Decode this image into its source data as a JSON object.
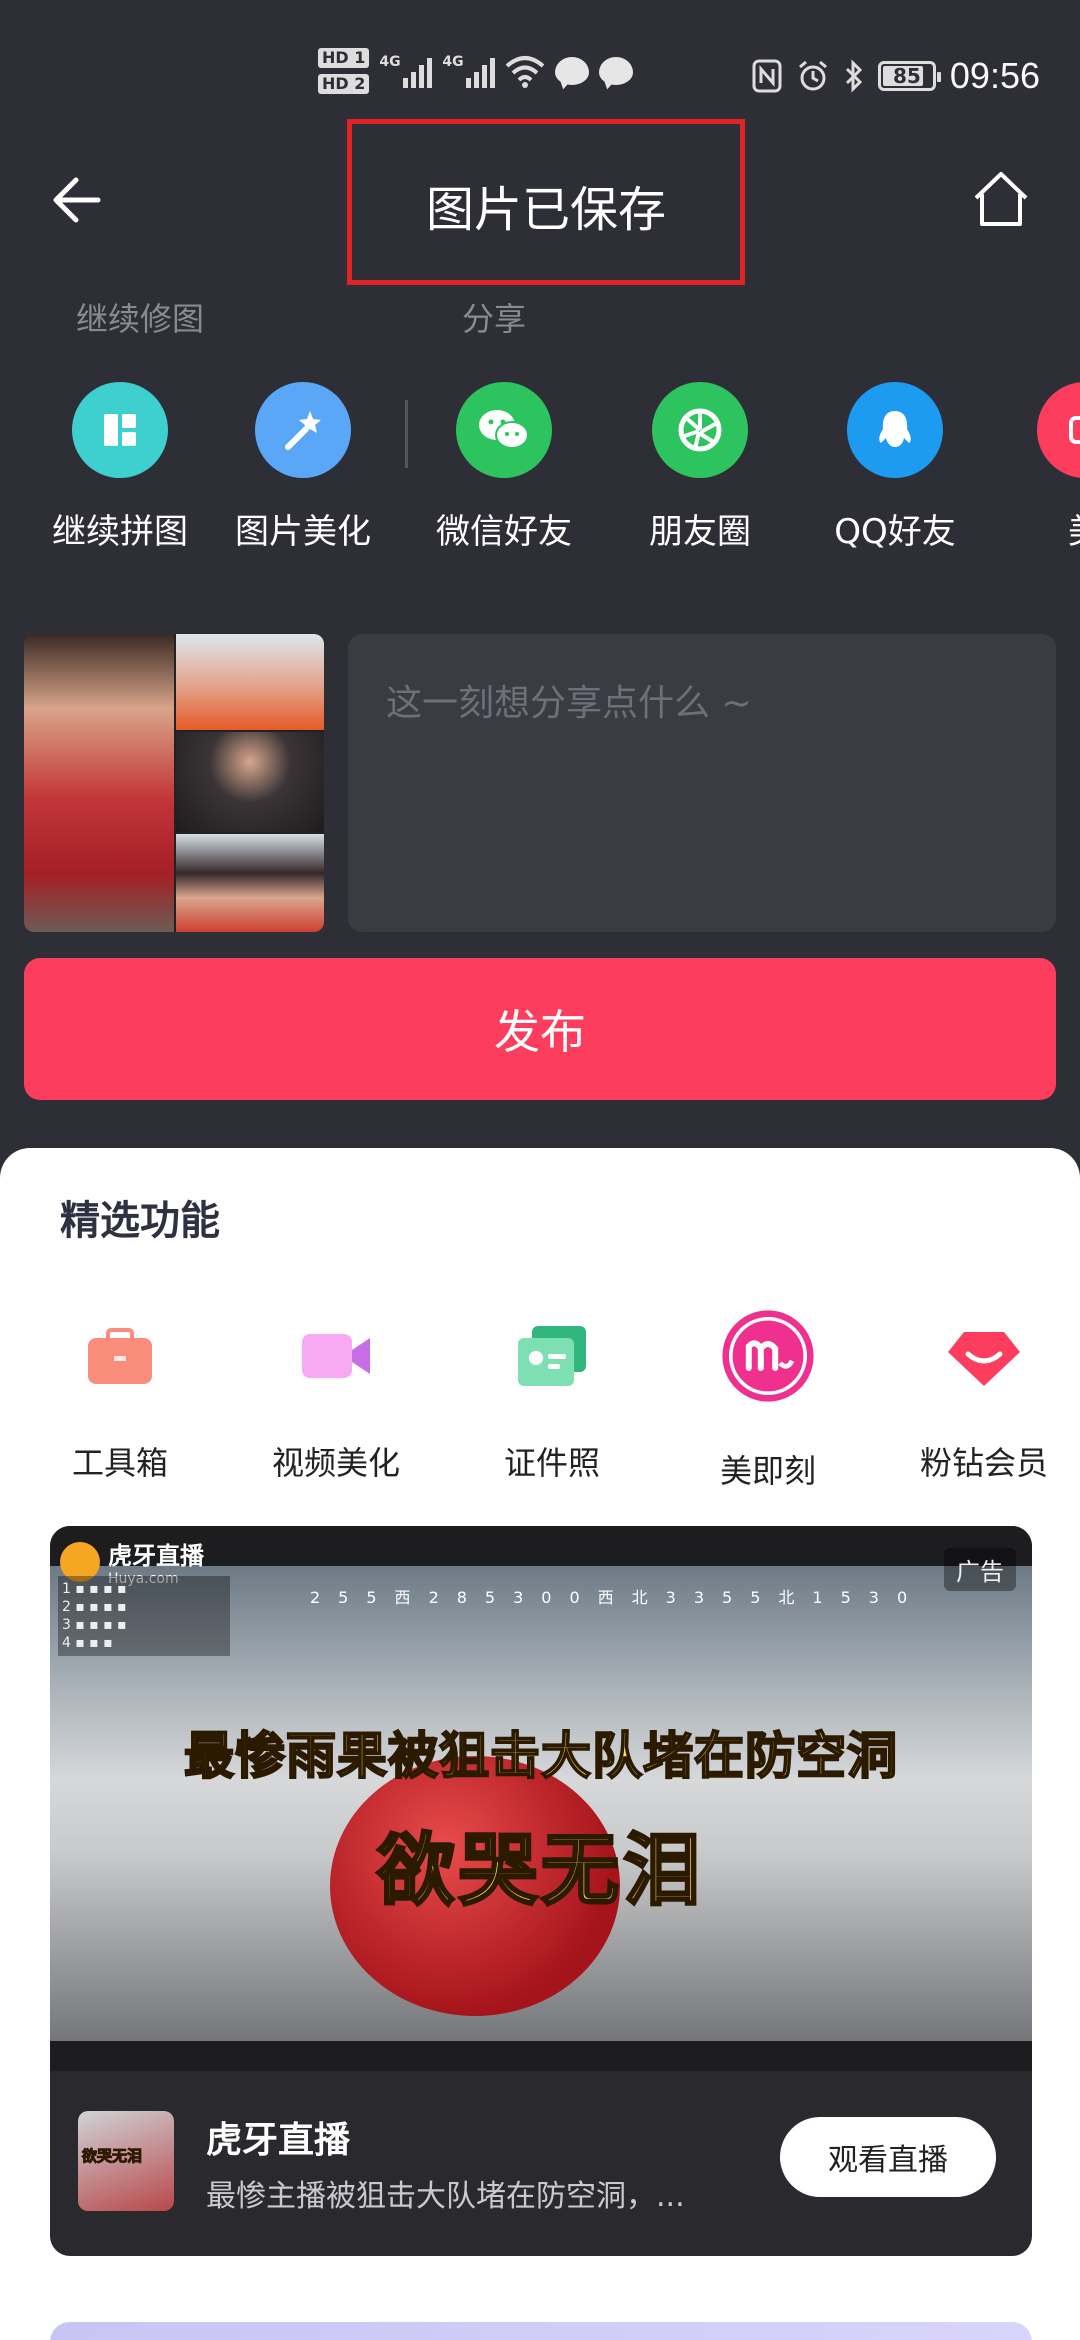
{
  "status_bar": {
    "time": "09:56",
    "battery": "85",
    "battery_level_percent": 85,
    "sim_badges": [
      "HD 1",
      "HD 2"
    ],
    "network_labels": [
      "4G",
      "4G"
    ]
  },
  "header": {
    "title": "图片已保存",
    "back_icon": "arrow-left-icon",
    "home_icon": "home-icon"
  },
  "sections": {
    "continue_edit": "继续修图",
    "share": "分享"
  },
  "actions": [
    {
      "label": "继续拼图",
      "icon": "collage-icon",
      "color": "#3ed0cf"
    },
    {
      "label": "图片美化",
      "icon": "magic-wand-icon",
      "color": "#5aa7f7"
    }
  ],
  "share_targets": [
    {
      "label": "微信好友",
      "icon": "wechat-icon",
      "color": "#2dc35f"
    },
    {
      "label": "朋友圈",
      "icon": "moments-icon",
      "color": "#2dc35f"
    },
    {
      "label": "QQ好友",
      "icon": "qq-icon",
      "color": "#1d9bf0"
    },
    {
      "label": "美",
      "icon": "meitu-icon",
      "color": "#fd3d5e"
    }
  ],
  "composer": {
    "placeholder": "这一刻想分享点什么 ~",
    "publish_label": "发布"
  },
  "featured": {
    "title": "精选功能",
    "items": [
      {
        "label": "工具箱",
        "icon": "toolbox-icon",
        "color": "#fa8c7c"
      },
      {
        "label": "视频美化",
        "icon": "video-camera-icon",
        "color": "#f28df2"
      },
      {
        "label": "证件照",
        "icon": "id-photo-icon",
        "color": "#3ec796"
      },
      {
        "label": "美即刻",
        "icon": "meijike-icon",
        "color": "#f0308f"
      },
      {
        "label": "粉钻会员",
        "icon": "diamond-icon",
        "color": "#fd3d5e"
      }
    ]
  },
  "ad": {
    "badge": "广告",
    "brand_watermark": "虎牙直播",
    "brand_url": "Huya.com",
    "caption_line1": "最惨雨果被狙击大队堵在防空洞",
    "caption_line2": "欲哭无泪",
    "thumb_caption": "欲哭无泪",
    "name": "虎牙直播",
    "description": "最惨主播被狙击大队堵在防空洞，...",
    "cta": "观看直播",
    "compass": [
      "255",
      "西",
      "285",
      "300",
      "西北",
      "335",
      "5",
      "北",
      "15",
      "30"
    ]
  }
}
